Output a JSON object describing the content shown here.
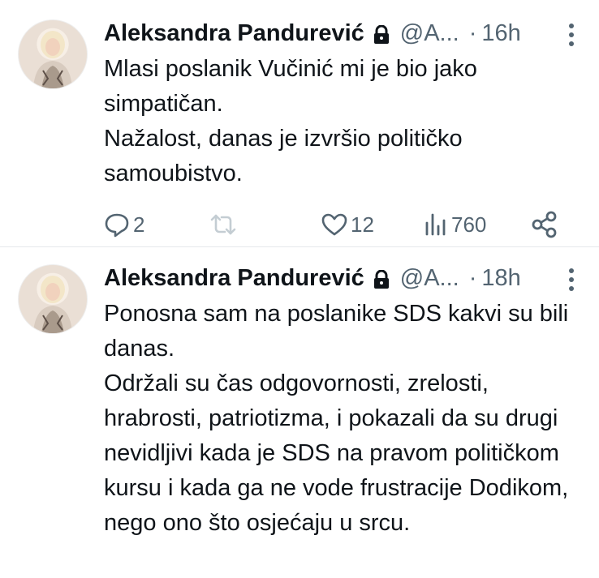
{
  "tweets": [
    {
      "author": "Aleksandra Pandurević",
      "handle": "@A...",
      "dot": "·",
      "time": "16h",
      "lines": [
        "Mlasi poslanik Vučinić mi je bio jako simpatičan.",
        "Nažalost, danas je izvršio političko samoubistvo."
      ],
      "replies": "2",
      "retweets": "",
      "likes": "12",
      "views": "760"
    },
    {
      "author": "Aleksandra Pandurević",
      "handle": "@A...",
      "dot": "·",
      "time": "18h",
      "lines": [
        "Ponosna sam na poslanike SDS kakvi su bili danas.",
        "Održali su čas odgovornosti, zrelosti, hrabrosti, patriotizma, i pokazali da su drugi nevidljivi kada je SDS na pravom političkom kursu i kada ga ne  vode frustracije Dodikom, nego ono što osjećaju u srcu."
      ]
    }
  ],
  "colors": {
    "text": "#0f1419",
    "secondary": "#536471",
    "divider": "#e6e9eb"
  },
  "icons": [
    "lock-icon",
    "more-icon",
    "reply-icon",
    "retweet-icon",
    "like-icon",
    "views-icon",
    "share-icon"
  ]
}
